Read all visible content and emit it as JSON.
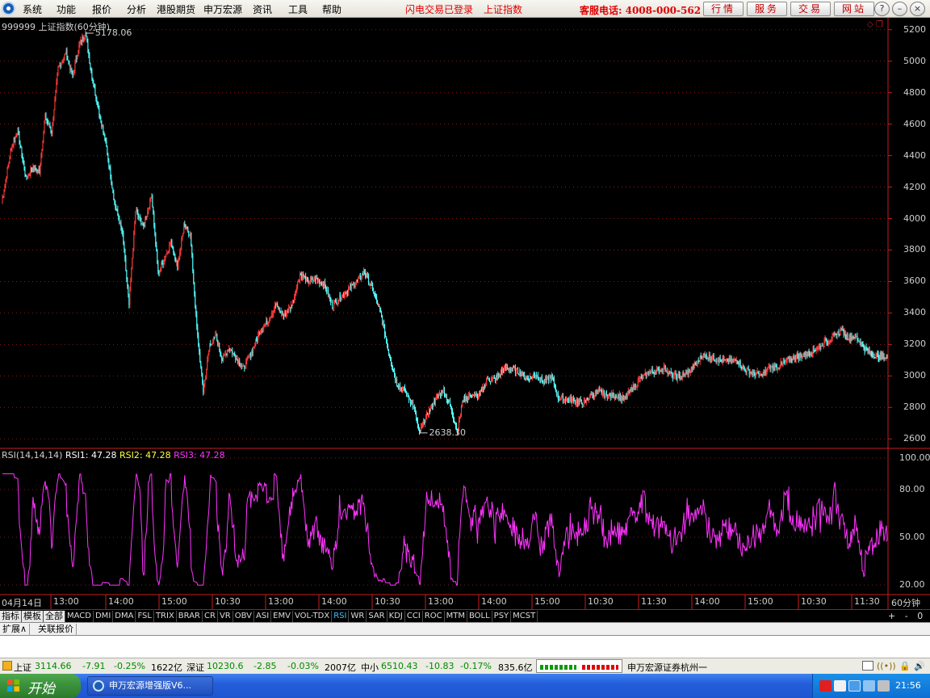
{
  "menu": {
    "items": [
      "系统",
      "功能",
      "报价",
      "分析",
      "港股期货",
      "申万宏源",
      "资讯",
      "工具",
      "帮助"
    ],
    "login_status": "闪电交易已登录",
    "index_name": "上证指数",
    "hotline": "客服电话: 4008-000-562",
    "buttons": [
      "行情",
      "服务",
      "交易",
      "网站"
    ]
  },
  "chart": {
    "title": "999999 上证指数(60分钟)",
    "high_label": "5178.06",
    "low_label": "2638.30",
    "timeframe": "60分钟",
    "price_axis": [
      "5200",
      "5000",
      "4800",
      "4600",
      "4400",
      "4200",
      "4000",
      "3800",
      "3600",
      "3400",
      "3200",
      "3000",
      "2800",
      "2600"
    ],
    "rsi_axis": [
      "100.00",
      "80.00",
      "50.00",
      "20.00"
    ],
    "rsi_legend": {
      "name": "RSI(14,14,14)",
      "rsi1_label": "RSI1:",
      "rsi1": "47.28",
      "rsi2_label": "RSI2:",
      "rsi2": "47.28",
      "rsi3_label": "RSI3:",
      "rsi3": "47.28"
    },
    "time_axis": [
      "04月14日",
      "13:00",
      "14:00",
      "15:00",
      "10:30",
      "13:00",
      "14:00",
      "10:30",
      "13:00",
      "14:00",
      "15:00",
      "10:30",
      "11:30",
      "14:00",
      "15:00",
      "10:30",
      "11:30"
    ],
    "colors": {
      "up": "#ff3c3c",
      "down": "#54ffff",
      "rsi": "#ff33ff",
      "axis": "#c81e1e",
      "grid": "#8a1a1a"
    }
  },
  "chart_data": {
    "type": "candlestick",
    "title": "999999 上证指数(60分钟)",
    "ylabel": "",
    "ylim": [
      2550,
      5250
    ],
    "annotations": [
      {
        "label": "5178.06",
        "value": 5178.06
      },
      {
        "label": "2638.30",
        "value": 2638.3
      }
    ],
    "price_path": [
      {
        "i": 0,
        "v": 4100
      },
      {
        "i": 12,
        "v": 4450
      },
      {
        "i": 20,
        "v": 4560
      },
      {
        "i": 30,
        "v": 4250
      },
      {
        "i": 38,
        "v": 4320
      },
      {
        "i": 47,
        "v": 4300
      },
      {
        "i": 54,
        "v": 4650
      },
      {
        "i": 62,
        "v": 4550
      },
      {
        "i": 70,
        "v": 4950
      },
      {
        "i": 80,
        "v": 5050
      },
      {
        "i": 88,
        "v": 4900
      },
      {
        "i": 96,
        "v": 5100
      },
      {
        "i": 104,
        "v": 5178
      },
      {
        "i": 112,
        "v": 4900
      },
      {
        "i": 120,
        "v": 4700
      },
      {
        "i": 130,
        "v": 4450
      },
      {
        "i": 140,
        "v": 4100
      },
      {
        "i": 150,
        "v": 3900
      },
      {
        "i": 158,
        "v": 3450
      },
      {
        "i": 166,
        "v": 4050
      },
      {
        "i": 176,
        "v": 3950
      },
      {
        "i": 186,
        "v": 4150
      },
      {
        "i": 194,
        "v": 3650
      },
      {
        "i": 202,
        "v": 3750
      },
      {
        "i": 210,
        "v": 3850
      },
      {
        "i": 218,
        "v": 3700
      },
      {
        "i": 226,
        "v": 3950
      },
      {
        "i": 234,
        "v": 3900
      },
      {
        "i": 242,
        "v": 3300
      },
      {
        "i": 250,
        "v": 2900
      },
      {
        "i": 258,
        "v": 3200
      },
      {
        "i": 266,
        "v": 3250
      },
      {
        "i": 274,
        "v": 3100
      },
      {
        "i": 282,
        "v": 3180
      },
      {
        "i": 290,
        "v": 3120
      },
      {
        "i": 300,
        "v": 3050
      },
      {
        "i": 310,
        "v": 3150
      },
      {
        "i": 320,
        "v": 3280
      },
      {
        "i": 330,
        "v": 3350
      },
      {
        "i": 340,
        "v": 3450
      },
      {
        "i": 350,
        "v": 3380
      },
      {
        "i": 360,
        "v": 3450
      },
      {
        "i": 370,
        "v": 3650
      },
      {
        "i": 380,
        "v": 3600
      },
      {
        "i": 390,
        "v": 3620
      },
      {
        "i": 400,
        "v": 3580
      },
      {
        "i": 410,
        "v": 3450
      },
      {
        "i": 420,
        "v": 3500
      },
      {
        "i": 430,
        "v": 3550
      },
      {
        "i": 440,
        "v": 3600
      },
      {
        "i": 450,
        "v": 3660
      },
      {
        "i": 460,
        "v": 3550
      },
      {
        "i": 470,
        "v": 3400
      },
      {
        "i": 480,
        "v": 3150
      },
      {
        "i": 490,
        "v": 2950
      },
      {
        "i": 500,
        "v": 2900
      },
      {
        "i": 510,
        "v": 2820
      },
      {
        "i": 518,
        "v": 2640
      },
      {
        "i": 528,
        "v": 2760
      },
      {
        "i": 538,
        "v": 2850
      },
      {
        "i": 548,
        "v": 2920
      },
      {
        "i": 558,
        "v": 2780
      },
      {
        "i": 565,
        "v": 2650
      },
      {
        "i": 572,
        "v": 2850
      },
      {
        "i": 582,
        "v": 2880
      },
      {
        "i": 592,
        "v": 2870
      },
      {
        "i": 602,
        "v": 2980
      },
      {
        "i": 612,
        "v": 2980
      },
      {
        "i": 622,
        "v": 3040
      },
      {
        "i": 632,
        "v": 3050
      },
      {
        "i": 642,
        "v": 3020
      },
      {
        "i": 652,
        "v": 2980
      },
      {
        "i": 662,
        "v": 3010
      },
      {
        "i": 672,
        "v": 2960
      },
      {
        "i": 682,
        "v": 3000
      },
      {
        "i": 690,
        "v": 2860
      },
      {
        "i": 700,
        "v": 2850
      },
      {
        "i": 710,
        "v": 2840
      },
      {
        "i": 722,
        "v": 2830
      },
      {
        "i": 732,
        "v": 2880
      },
      {
        "i": 742,
        "v": 2900
      },
      {
        "i": 752,
        "v": 2870
      },
      {
        "i": 762,
        "v": 2880
      },
      {
        "i": 772,
        "v": 2850
      },
      {
        "i": 782,
        "v": 2920
      },
      {
        "i": 792,
        "v": 2980
      },
      {
        "i": 802,
        "v": 3020
      },
      {
        "i": 812,
        "v": 3030
      },
      {
        "i": 822,
        "v": 3050
      },
      {
        "i": 832,
        "v": 3000
      },
      {
        "i": 842,
        "v": 2990
      },
      {
        "i": 852,
        "v": 3030
      },
      {
        "i": 862,
        "v": 3080
      },
      {
        "i": 868,
        "v": 3130
      },
      {
        "i": 878,
        "v": 3120
      },
      {
        "i": 890,
        "v": 3100
      },
      {
        "i": 900,
        "v": 3090
      },
      {
        "i": 912,
        "v": 3100
      },
      {
        "i": 922,
        "v": 3040
      },
      {
        "i": 932,
        "v": 3020
      },
      {
        "i": 942,
        "v": 3000
      },
      {
        "i": 952,
        "v": 3050
      },
      {
        "i": 962,
        "v": 3060
      },
      {
        "i": 972,
        "v": 3090
      },
      {
        "i": 982,
        "v": 3120
      },
      {
        "i": 992,
        "v": 3130
      },
      {
        "i": 1002,
        "v": 3150
      },
      {
        "i": 1012,
        "v": 3180
      },
      {
        "i": 1022,
        "v": 3220
      },
      {
        "i": 1032,
        "v": 3250
      },
      {
        "i": 1042,
        "v": 3290
      },
      {
        "i": 1050,
        "v": 3240
      },
      {
        "i": 1058,
        "v": 3260
      },
      {
        "i": 1066,
        "v": 3200
      },
      {
        "i": 1074,
        "v": 3150
      },
      {
        "i": 1086,
        "v": 3130
      },
      {
        "i": 1098,
        "v": 3115
      }
    ],
    "rsi": {
      "ylim": [
        15,
        105
      ],
      "series": [
        {
          "name": "RSI1",
          "last": 47.28,
          "range": [
            20,
            90
          ]
        }
      ]
    }
  },
  "indicators": {
    "cn_tabs": [
      "指标",
      "模板",
      "全部"
    ],
    "tabs": [
      "MACD",
      "DMI",
      "DMA",
      "FSL",
      "TRIX",
      "BRAR",
      "CR",
      "VR",
      "OBV",
      "ASI",
      "EMV",
      "VOL-TDX",
      "RSI",
      "WR",
      "SAR",
      "KDJ",
      "CCI",
      "ROC",
      "MTM",
      "BOLL",
      "PSY",
      "MCST"
    ],
    "active": "RSI",
    "zoom": [
      "+",
      "-",
      "0"
    ]
  },
  "expand_bar": {
    "tabs": [
      "扩展∧",
      "关联报价"
    ]
  },
  "status": {
    "sh_label": "上证",
    "sh_value": "3114.66",
    "sh_change": "-7.91",
    "sh_pct": "-0.25%",
    "sh_amount": "1622亿",
    "sz_label": "深证",
    "sz_value": "10230.6",
    "sz_change": "-2.85",
    "sz_pct": "-0.03%",
    "sz_amount": "2007亿",
    "zx_label": "中小",
    "zx_value": "6510.43",
    "zx_change": "-10.83",
    "zx_pct": "-0.17%",
    "zx_amount": "835.6亿",
    "broker": "申万宏源证券杭州一"
  },
  "taskbar": {
    "start": "开始",
    "task": "申万宏源增强版V6...",
    "clock": "21:56"
  }
}
